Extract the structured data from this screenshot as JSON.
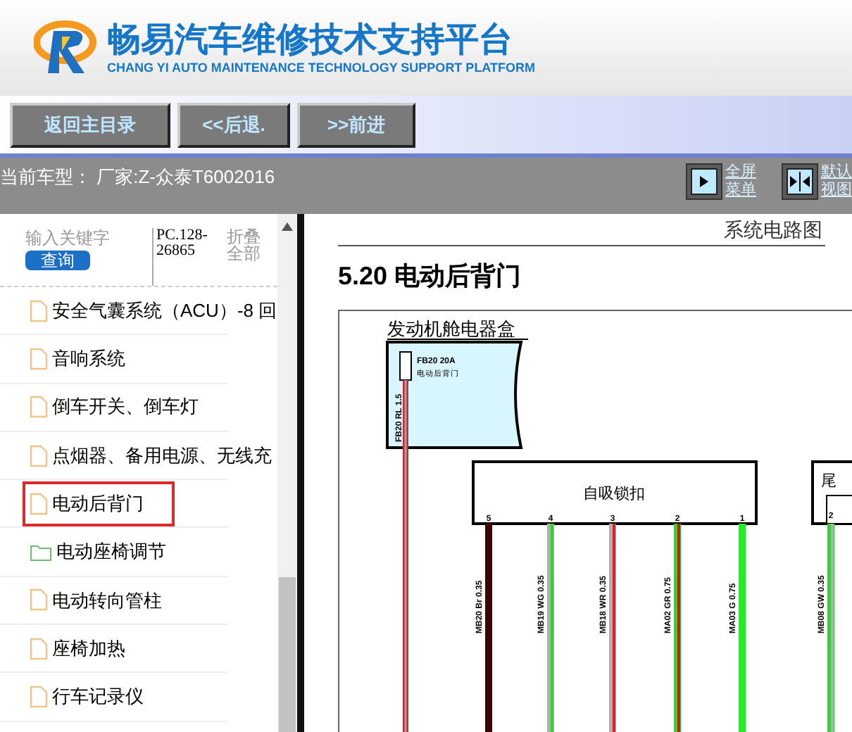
{
  "header": {
    "title": "畅易汽车维修技术支持平台",
    "subtitle": "CHANG YI AUTO MAINTENANCE TECHNOLOGY SUPPORT PLATFORM"
  },
  "nav_buttons": [
    "返回主目录",
    "<<后退.",
    ">>前进"
  ],
  "vehicle_bar": {
    "text": "当前车型：  厂家:Z-众泰T6002016",
    "view_buttons": [
      {
        "kind": "full",
        "lines": [
          "全屏",
          "菜单"
        ]
      },
      {
        "kind": "default",
        "lines": [
          "默认",
          "视图"
        ]
      }
    ]
  },
  "sidebar": {
    "search": {
      "placeholder": "输入关键字",
      "button": "查询"
    },
    "code": "PC.128-26865",
    "collapse": "折叠全部",
    "items": [
      {
        "label": "安全气囊系统（ACU）-8 回",
        "kind": "file",
        "selected": false
      },
      {
        "label": "音响系统",
        "kind": "file",
        "selected": false
      },
      {
        "label": "倒车开关、倒车灯",
        "kind": "file",
        "selected": false
      },
      {
        "label": "点烟器、备用电源、无线充",
        "kind": "file",
        "selected": false
      },
      {
        "label": "电动后背门",
        "kind": "file",
        "selected": true
      },
      {
        "label": "电动座椅调节",
        "kind": "folder",
        "selected": false
      },
      {
        "label": "电动转向管柱",
        "kind": "file",
        "selected": false
      },
      {
        "label": "座椅加热",
        "kind": "file",
        "selected": false
      },
      {
        "label": "行车记录仪",
        "kind": "file",
        "selected": false
      }
    ]
  },
  "document": {
    "section": "系统电路图",
    "title": "5.20 电动后背门",
    "diagram": {
      "fuse_box": "发动机舱电器盒",
      "fuse": "FB20 20A",
      "fuse_desc": "电动后背门",
      "feed_wire": "FB20 RL 1.5",
      "connector": "自吸锁扣",
      "wires": [
        {
          "pin": "5",
          "label": "MB20 Br 0.35",
          "color": "#3a0505",
          "stripe": {
            "color": "#3a0505"
          }
        },
        {
          "pin": "4",
          "label": "MB19 WG 0.35",
          "color": "#b0b0b0",
          "stripe": {
            "color": "#22dd22"
          }
        },
        {
          "pin": "3",
          "label": "MB18 WR 0.35",
          "color": "#b0b0b0",
          "stripe": {
            "color": "#e02020"
          }
        },
        {
          "pin": "2",
          "label": "MA02 GR 0.75",
          "color": "#22dd22",
          "stripe": {
            "color": "#c02020"
          }
        },
        {
          "pin": "1",
          "label": "MA03 G 0.75",
          "color": "#22ee22",
          "stripe": {
            "color": "#22ee22"
          }
        }
      ],
      "connector_2": "尾",
      "connector_2_wires": [
        {
          "pin": "2",
          "label": "MB08 GW 0.35",
          "color": "#22dd22",
          "stripe": {
            "color": "#b0b0b0"
          }
        }
      ]
    }
  }
}
